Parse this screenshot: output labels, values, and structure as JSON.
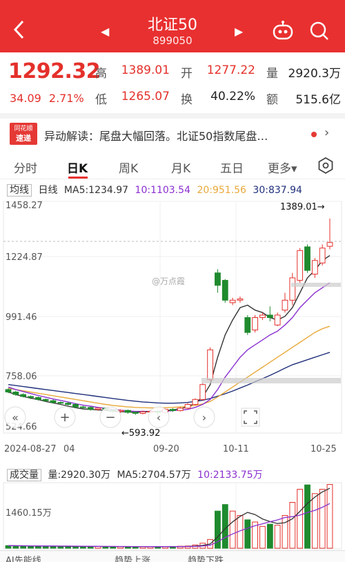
{
  "header": {
    "title": "北证50",
    "code": "899050"
  },
  "quote": {
    "price": "1292.32",
    "change": "34.09",
    "change_pct": "2.71%",
    "high_label": "高",
    "high": "1389.01",
    "open_label": "开",
    "open": "1277.22",
    "volume_label": "量",
    "volume": "2920.3万",
    "low_label": "低",
    "low": "1265.07",
    "turnover_label": "换",
    "turnover": "40.22%",
    "amount_label": "额",
    "amount": "515.6亿"
  },
  "news": {
    "badge_top": "同花顺",
    "badge_bottom": "速递",
    "text": "异动解读：尾盘大幅回落。北证50指数尾盘…"
  },
  "tabs": [
    "分时",
    "日K",
    "周K",
    "月K",
    "五日",
    "更多▾"
  ],
  "ma_line": {
    "mode": "均线",
    "period": "日线",
    "ma5": "MA5:1234.97",
    "ma10": "10:1103.54",
    "ma20": "20:951.56",
    "ma30": "30:837.94"
  },
  "kline_axis": {
    "y_ticks": [
      "1458.27",
      "1224.87",
      "991.46",
      "758.06",
      "524.66"
    ],
    "x_labels": [
      "2024-08-27",
      "09-20",
      "10-11",
      "10-25"
    ],
    "x_label_partial": "04",
    "max_marker": "1389.01→",
    "min_marker": "←593.92",
    "watermark": "@万点霞"
  },
  "volume_line": {
    "label": "成交量",
    "vol": "量:2920.30万",
    "ma5": "MA5:2704.57万",
    "ma10": "10:2133.75万",
    "y_tick": "1460.15万"
  },
  "bottom_partial": {
    "item1": "AI先能线",
    "item2": "趋势上涨",
    "item3": "趋势下跌"
  },
  "colors": {
    "up": "#e4302b",
    "down": "#1f8a2e",
    "header": "#e93030",
    "ma5": "#333333",
    "ma10": "#8b2fd0",
    "ma20": "#e8a93a",
    "ma30": "#1f2f7a"
  },
  "chart_data": {
    "type": "candlestick",
    "ylim": [
      524.66,
      1458.27
    ],
    "candles": [
      {
        "o": 700,
        "c": 690,
        "h": 705,
        "l": 685
      },
      {
        "o": 690,
        "c": 680,
        "h": 695,
        "l": 675
      },
      {
        "o": 680,
        "c": 672,
        "h": 685,
        "l": 668
      },
      {
        "o": 672,
        "c": 668,
        "h": 676,
        "l": 662
      },
      {
        "o": 668,
        "c": 660,
        "h": 672,
        "l": 655
      },
      {
        "o": 660,
        "c": 655,
        "h": 664,
        "l": 650
      },
      {
        "o": 655,
        "c": 648,
        "h": 660,
        "l": 644
      },
      {
        "o": 648,
        "c": 645,
        "h": 652,
        "l": 640
      },
      {
        "o": 645,
        "c": 640,
        "h": 650,
        "l": 636
      },
      {
        "o": 640,
        "c": 630,
        "h": 645,
        "l": 626
      },
      {
        "o": 630,
        "c": 628,
        "h": 634,
        "l": 622
      },
      {
        "o": 628,
        "c": 620,
        "h": 632,
        "l": 615
      },
      {
        "o": 620,
        "c": 625,
        "h": 628,
        "l": 615
      },
      {
        "o": 625,
        "c": 618,
        "h": 628,
        "l": 612
      },
      {
        "o": 618,
        "c": 612,
        "h": 622,
        "l": 608
      },
      {
        "o": 612,
        "c": 616,
        "h": 620,
        "l": 606
      },
      {
        "o": 616,
        "c": 608,
        "h": 619,
        "l": 602
      },
      {
        "o": 608,
        "c": 604,
        "h": 612,
        "l": 598
      },
      {
        "o": 604,
        "c": 610,
        "h": 615,
        "l": 600
      },
      {
        "o": 610,
        "c": 612,
        "h": 617,
        "l": 605
      },
      {
        "o": 612,
        "c": 608,
        "h": 616,
        "l": 594
      },
      {
        "o": 608,
        "c": 620,
        "h": 624,
        "l": 604
      },
      {
        "o": 620,
        "c": 615,
        "h": 625,
        "l": 610
      },
      {
        "o": 615,
        "c": 625,
        "h": 630,
        "l": 612
      },
      {
        "o": 625,
        "c": 640,
        "h": 645,
        "l": 620
      },
      {
        "o": 640,
        "c": 660,
        "h": 665,
        "l": 636
      },
      {
        "o": 660,
        "c": 720,
        "h": 725,
        "l": 655
      },
      {
        "o": 740,
        "c": 860,
        "h": 870,
        "l": 735
      },
      {
        "o": 1170,
        "c": 1120,
        "h": 1185,
        "l": 1090
      },
      {
        "o": 1140,
        "c": 1060,
        "h": 1145,
        "l": 1050
      },
      {
        "o": 1050,
        "c": 1060,
        "h": 1070,
        "l": 1040
      },
      {
        "o": 1060,
        "c": 1065,
        "h": 1075,
        "l": 1050
      },
      {
        "o": 990,
        "c": 930,
        "h": 1000,
        "l": 920
      },
      {
        "o": 940,
        "c": 990,
        "h": 1000,
        "l": 930
      },
      {
        "o": 990,
        "c": 1000,
        "h": 1010,
        "l": 980
      },
      {
        "o": 1000,
        "c": 990,
        "h": 1035,
        "l": 975
      },
      {
        "o": 960,
        "c": 1000,
        "h": 1010,
        "l": 955
      },
      {
        "o": 1020,
        "c": 1060,
        "h": 1090,
        "l": 1010
      },
      {
        "o": 1060,
        "c": 1150,
        "h": 1170,
        "l": 1040
      },
      {
        "o": 1140,
        "c": 1260,
        "h": 1270,
        "l": 1130
      },
      {
        "o": 1275,
        "c": 1180,
        "h": 1285,
        "l": 1170
      },
      {
        "o": 1165,
        "c": 1220,
        "h": 1230,
        "l": 1150
      },
      {
        "o": 1210,
        "c": 1270,
        "h": 1285,
        "l": 1200
      },
      {
        "o": 1277.22,
        "c": 1292.32,
        "h": 1389.01,
        "l": 1265.07
      }
    ],
    "ma5": [
      690,
      680,
      672,
      665,
      660,
      652,
      646,
      640,
      633,
      627,
      622,
      620,
      618,
      616,
      612,
      611,
      609,
      608,
      610,
      611,
      612,
      615,
      618,
      623,
      630,
      645,
      670,
      720,
      830,
      920,
      980,
      1030,
      1040,
      1020,
      1010,
      990,
      980,
      995,
      1030,
      1090,
      1150,
      1180,
      1220,
      1240
    ],
    "ma10": [
      710,
      700,
      692,
      684,
      676,
      669,
      662,
      656,
      650,
      643,
      637,
      633,
      628,
      624,
      620,
      617,
      614,
      612,
      612,
      612,
      612,
      613,
      615,
      617,
      620,
      628,
      640,
      660,
      700,
      750,
      790,
      830,
      860,
      880,
      900,
      920,
      935,
      960,
      990,
      1030,
      1060,
      1090,
      1110,
      1130
    ],
    "ma20": [
      705,
      700,
      695,
      690,
      685,
      680,
      675,
      670,
      665,
      660,
      655,
      650,
      645,
      640,
      636,
      633,
      630,
      628,
      627,
      626,
      626,
      627,
      628,
      630,
      632,
      636,
      642,
      652,
      670,
      690,
      710,
      730,
      750,
      770,
      790,
      810,
      830,
      850,
      870,
      890,
      910,
      930,
      945,
      955
    ],
    "ma30": [
      720,
      716,
      712,
      708,
      704,
      700,
      696,
      692,
      688,
      684,
      680,
      676,
      672,
      668,
      664,
      660,
      656,
      653,
      650,
      648,
      646,
      645,
      645,
      646,
      648,
      652,
      657,
      664,
      673,
      683,
      694,
      706,
      718,
      731,
      744,
      757,
      771,
      786,
      800,
      810,
      820,
      830,
      840,
      850
    ],
    "volume": [
      120,
      110,
      100,
      100,
      95,
      90,
      90,
      85,
      85,
      80,
      80,
      78,
      78,
      75,
      75,
      72,
      72,
      70,
      70,
      70,
      70,
      75,
      80,
      90,
      100,
      150,
      230,
      400,
      1700,
      2000,
      1700,
      1500,
      1300,
      1200,
      1000,
      1100,
      1050,
      1500,
      2100,
      2700,
      2900,
      2500,
      2700,
      2920
    ]
  }
}
